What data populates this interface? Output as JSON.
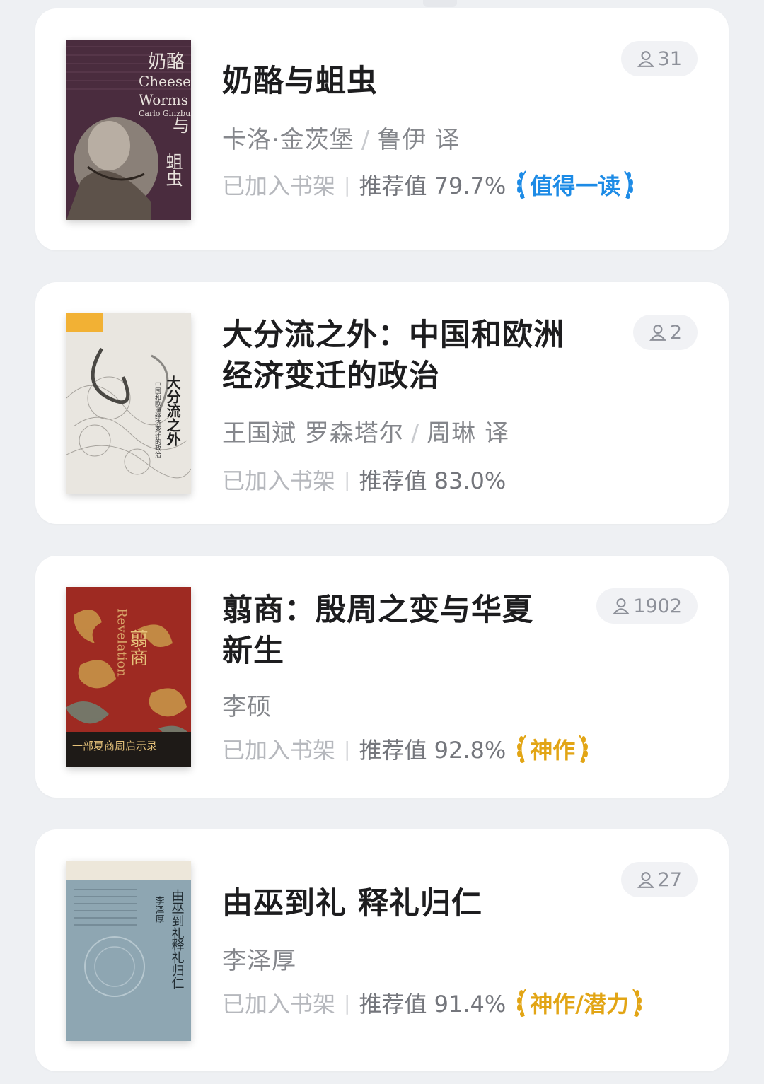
{
  "colors": {
    "badge_blue": "#1d8be6",
    "badge_gold": "#e2a515",
    "card_bg": "#ffffff",
    "page_bg": "#eef0f3"
  },
  "books": [
    {
      "title": "奶酪与蛆虫",
      "author": "卡洛·金茨堡",
      "translator": "鲁伊 译",
      "shelf_status": "已加入书架",
      "recommend": "推荐值 79.7%",
      "badge": "值得一读",
      "badge_color": "blue",
      "readers": "31",
      "cover": {
        "bg": "#4a2c3e",
        "text_cn": "奶酪",
        "text_en1": "Cheese",
        "text_en2": "Worms",
        "text_cn2": "与",
        "text_cn3": "蛆虫",
        "author_en": "Carlo Ginzburg"
      }
    },
    {
      "title": "大分流之外：中国和欧洲经济变迁的政治",
      "author": "王国斌 罗森塔尔",
      "translator": "周琳 译",
      "shelf_status": "已加入书架",
      "recommend": "推荐值 83.0%",
      "badge": "",
      "badge_color": "",
      "readers": "2",
      "cover": {
        "bg": "#e9e6e0",
        "text_cn": "大分流之外",
        "subtitle": "中国和欧洲经济变迁的政治"
      }
    },
    {
      "title": "翦商：殷周之变与华夏新生",
      "author": "李硕",
      "translator": "",
      "shelf_status": "已加入书架",
      "recommend": "推荐值 92.8%",
      "badge": "神作",
      "badge_color": "gold",
      "readers": "1902",
      "cover": {
        "bg": "#9e2a22",
        "text_cn": "翦商",
        "text_en": "Revelation",
        "tagline": "一部夏商周启示录"
      }
    },
    {
      "title": "由巫到礼 释礼归仁",
      "author": "李泽厚",
      "translator": "",
      "shelf_status": "已加入书架",
      "recommend": "推荐值 91.4%",
      "badge": "神作/潜力",
      "badge_color": "gold",
      "readers": "27",
      "cover": {
        "bg": "#8ea6b2",
        "text_cn": "由巫到礼",
        "text_cn2": "释礼归仁",
        "author_cn": "李泽厚"
      }
    }
  ]
}
